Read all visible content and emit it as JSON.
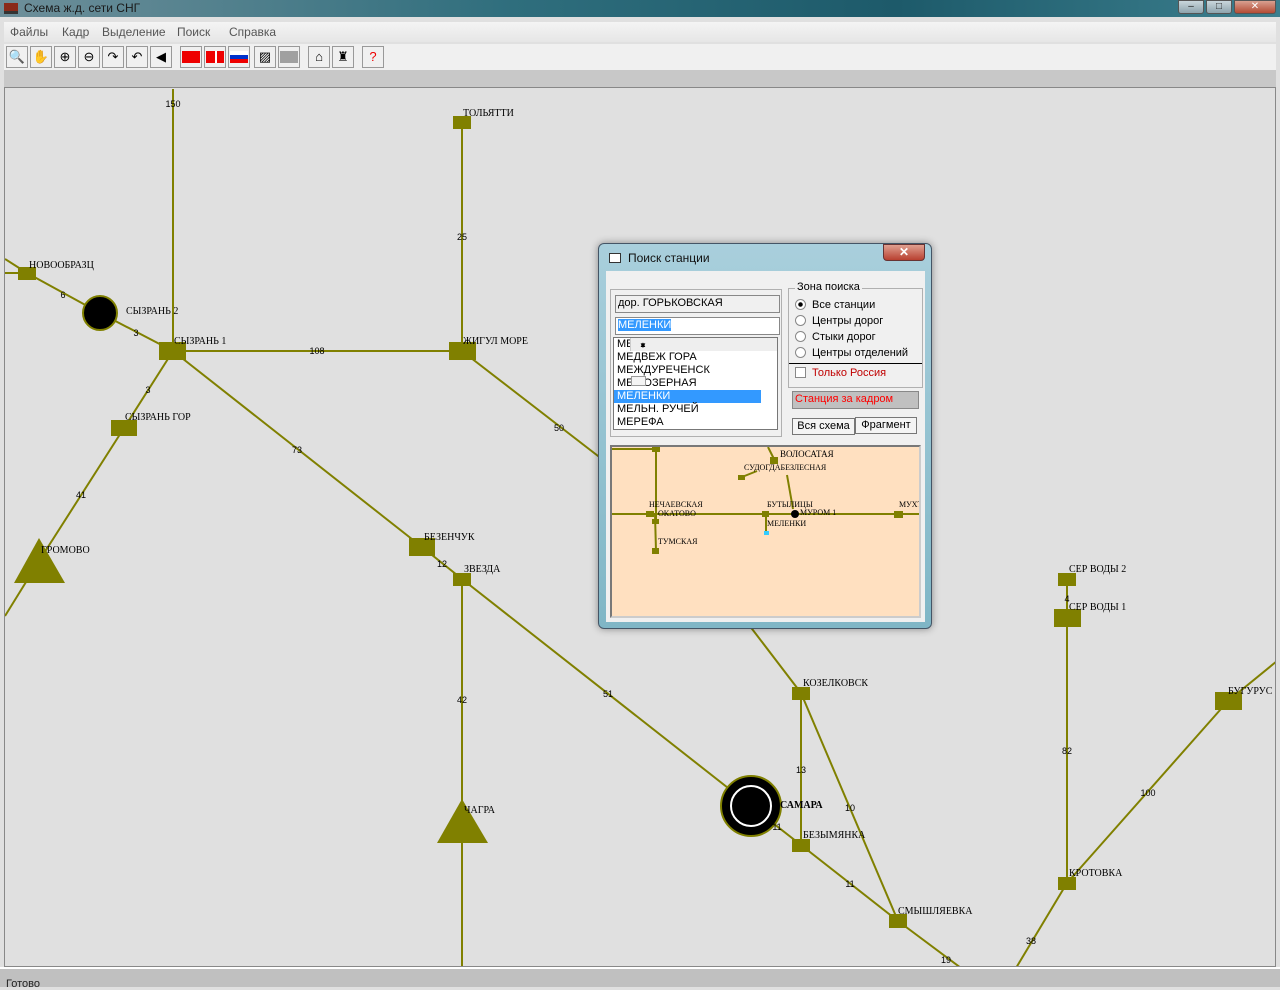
{
  "window": {
    "title": "Схема ж.д. сети СНГ",
    "controls": [
      "–",
      "□",
      "✕"
    ]
  },
  "menu": [
    "Файлы",
    "Кадр",
    "Выделение",
    "Поиск",
    "Справка"
  ],
  "toolbar": [
    {
      "icon": "search-icon",
      "g": "🔍"
    },
    {
      "icon": "hand-icon",
      "g": "✋"
    },
    {
      "icon": "zoom-in-icon",
      "g": "⊕"
    },
    {
      "icon": "zoom-out-icon",
      "g": "⊖"
    },
    {
      "icon": "redo-icon",
      "g": "↷"
    },
    {
      "icon": "undo-icon",
      "g": "↶"
    },
    {
      "icon": "back-icon",
      "g": "◀"
    },
    {
      "icon": "flag-china-icon",
      "g": ""
    },
    {
      "icon": "flag-mixed-icon",
      "g": ""
    },
    {
      "icon": "flag-russia-icon",
      "g": ""
    },
    {
      "icon": "grid-icon",
      "g": "▨"
    },
    {
      "icon": "blank-icon",
      "g": ""
    },
    {
      "icon": "station-icon",
      "g": "⌂"
    },
    {
      "icon": "train-icon",
      "g": "♜"
    },
    {
      "icon": "help-icon",
      "g": "?"
    }
  ],
  "colors": {
    "track": "#808000",
    "map_bg": "#e0e0e0",
    "mini_bg": "#ffe0c0",
    "selection": "#3399ff",
    "warning": "#ff0000"
  },
  "map": {
    "stations": [
      "ТОЛЬЯТТИ",
      "НОВООБРАЗЦ",
      "СЫЗРАНЬ 2",
      "СЫЗРАНЬ 1",
      "ЖИГУЛ МОРЕ",
      "СЫЗРАНЬ ГОР",
      "ГРОМОВО",
      "БЕЗЕНЧУК",
      "ЗВЕЗДА",
      "ЧАГРА",
      "КОЗЕЛКОВСК",
      "САМАРА",
      "БЕЗЫМЯНКА",
      "СМЫШЛЯЕВКА",
      "СЕР ВОДЫ 2",
      "СЕР ВОДЫ 1",
      "КРОТОВКА",
      "БУГУРУС"
    ],
    "distances": [
      "150",
      "6",
      "3",
      "108",
      "25",
      "3",
      "41",
      "73",
      "12",
      "50",
      "42",
      "51",
      "13",
      "10",
      "11",
      "11",
      "19",
      "4",
      "82",
      "38",
      "100"
    ]
  },
  "dialog": {
    "title": "Поиск станции",
    "road": "дор. ГОРЬКОВСКАЯ",
    "search_value": "МЕЛЕНКИ",
    "list": [
      "МЕГЕТ",
      "МЕДВЕЖ ГОРА",
      "МЕЖДУРЕЧЕНСК",
      "МЕЖОЗЕРНАЯ",
      "МЕЛЕНКИ",
      "МЕЛЬН. РУЧЕЙ",
      "МЕРЕФА"
    ],
    "selected_index": 4,
    "zone_title": "Зона поиска",
    "zone_options": [
      "Все станции",
      "Центры дорог",
      "Стыки дорог",
      "Центры отделений"
    ],
    "zone_selected": "Все станции",
    "russia_only_label": "Только Россия",
    "russia_only_checked": false,
    "status": "Станция за кадром",
    "btn_all": "Вся схема",
    "btn_fragment": "Фрагмент",
    "mini_labels": [
      "ВОЛОСАТАЯ",
      "СУДОГДАБЕЗЛЕСНАЯ",
      "НЕЧАЕВСКАЯ",
      "ОКАТОВО",
      "БУТЫЛИЦЫ",
      "МУРОМ 1",
      "МЕЛЕНКИ",
      "ТУМСКАЯ",
      "МУХТ"
    ]
  },
  "statusbar": "Готово"
}
